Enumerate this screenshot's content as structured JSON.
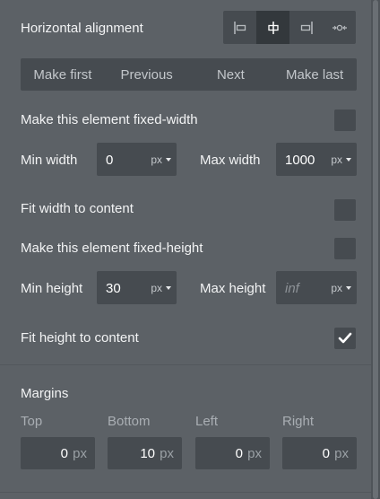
{
  "horizontal_alignment": {
    "label": "Horizontal alignment",
    "buttons": [
      {
        "icon": "align-left-icon",
        "active": false
      },
      {
        "icon": "align-center-icon",
        "active": true
      },
      {
        "icon": "align-right-icon",
        "active": false
      },
      {
        "icon": "align-distribute-icon",
        "active": false
      }
    ]
  },
  "order_buttons": {
    "make_first": "Make first",
    "previous": "Previous",
    "next": "Next",
    "make_last": "Make last"
  },
  "fixed_width": {
    "label": "Make this element fixed-width",
    "checked": false
  },
  "width": {
    "min_label": "Min width",
    "min_value": "0",
    "min_unit": "px",
    "max_label": "Max width",
    "max_value": "1000",
    "max_unit": "px"
  },
  "fit_width": {
    "label": "Fit width to content",
    "checked": false
  },
  "fixed_height": {
    "label": "Make this element fixed-height",
    "checked": false
  },
  "height": {
    "min_label": "Min height",
    "min_value": "30",
    "min_unit": "px",
    "max_label": "Max height",
    "max_placeholder": "inf",
    "max_unit": "px"
  },
  "fit_height": {
    "label": "Fit height to content",
    "checked": true
  },
  "margins": {
    "title": "Margins",
    "top_label": "Top",
    "bottom_label": "Bottom",
    "left_label": "Left",
    "right_label": "Right",
    "top_value": "0",
    "bottom_value": "10",
    "left_value": "0",
    "right_value": "0",
    "unit": "px"
  },
  "colors": {
    "panel_bg": "#5c6166",
    "field_bg": "#464b50",
    "active_bg": "#33383c",
    "text": "#f2f3f4",
    "muted_text": "#a9aeb3"
  }
}
